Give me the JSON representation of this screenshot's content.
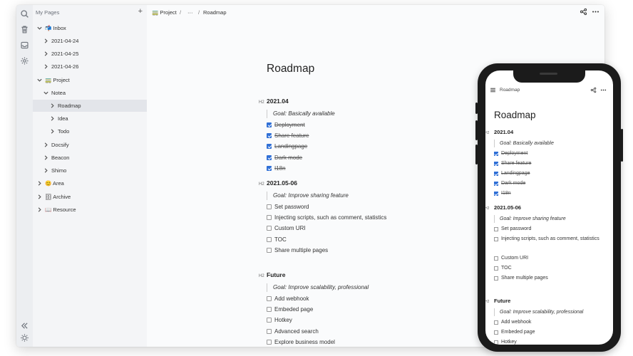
{
  "sidebar": {
    "title": "My Pages",
    "add_icon": "plus-icon",
    "items": [
      {
        "label": "📬 Inbox",
        "expanded": true
      },
      {
        "label": "2021-04-24",
        "expanded": false
      },
      {
        "label": "2021-04-25",
        "expanded": false
      },
      {
        "label": "2021-04-26",
        "expanded": false
      },
      {
        "label": "🚃 Project",
        "expanded": true
      },
      {
        "label": "Notea",
        "expanded": true
      },
      {
        "label": "Roadmap",
        "expanded": false,
        "selected": true
      },
      {
        "label": "Idea",
        "expanded": false
      },
      {
        "label": "Todo",
        "expanded": false
      },
      {
        "label": "Docsify",
        "expanded": false
      },
      {
        "label": "Beacon",
        "expanded": false
      },
      {
        "label": "Shimo",
        "expanded": false
      },
      {
        "label": "😊 Area",
        "expanded": false
      },
      {
        "label": "🗄 Archive",
        "expanded": false
      },
      {
        "label": "📖 Resource",
        "expanded": false
      }
    ]
  },
  "rail": {
    "icons": [
      "search-icon",
      "trash-icon",
      "inbox-icon",
      "settings-icon",
      "collapse-icon",
      "theme-icon"
    ]
  },
  "topbar": {
    "breadcrumb": [
      "🚃 Project",
      "/",
      "···",
      "/",
      "Roadmap"
    ],
    "share_icon": "share-icon",
    "more_icon": "more-icon"
  },
  "document": {
    "title": "Roadmap",
    "h2_tag": "H2",
    "sections": [
      {
        "heading": "2021.04",
        "goal": "Goal: Basically available",
        "tasks": [
          {
            "text": "Deployment",
            "done": true
          },
          {
            "text": "Share feature",
            "done": true
          },
          {
            "text": "Landingpage",
            "done": true
          },
          {
            "text": "Dark mode",
            "done": true
          },
          {
            "text": "I18n",
            "done": true
          }
        ]
      },
      {
        "heading": "2021.05-06",
        "goal": "Goal: Improve sharing feature",
        "tasks": [
          {
            "text": "Set password",
            "done": false
          },
          {
            "text": "Injecting scripts, such as comment, statistics",
            "done": false
          },
          {
            "text": "Custom URI",
            "done": false
          },
          {
            "text": "TOC",
            "done": false
          },
          {
            "text": "Share multiple pages",
            "done": false
          }
        ]
      },
      {
        "heading": "Future",
        "goal": "Goal: Improve scalability, professional",
        "tasks": [
          {
            "text": "Add webhook",
            "done": false
          },
          {
            "text": "Embeded page",
            "done": false
          },
          {
            "text": "Hotkey",
            "done": false
          },
          {
            "text": "Advanced search",
            "done": false
          },
          {
            "text": "Explore business model",
            "done": false
          }
        ]
      }
    ]
  },
  "phone": {
    "breadcrumb": "Roadmap",
    "menu_icon": "menu-icon",
    "share_icon": "share-icon",
    "more_icon": "more-icon"
  },
  "colors": {
    "accent": "#2f6fd6",
    "sidebar_bg": "#f4f5f7",
    "rail_bg": "#eceef1",
    "selected_bg": "#e3e5ea"
  }
}
